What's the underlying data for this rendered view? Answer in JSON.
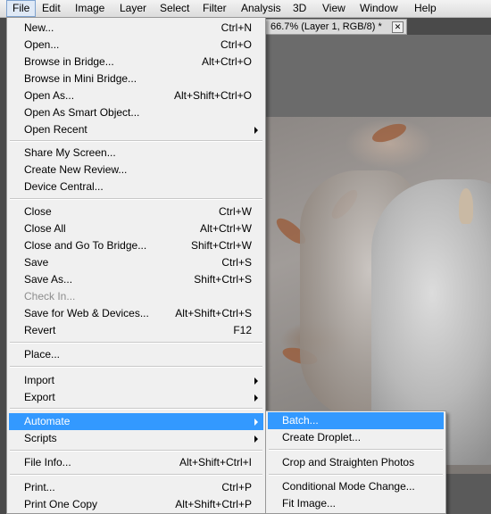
{
  "menubar": {
    "items": [
      {
        "label": "File",
        "active": true
      },
      {
        "label": "Edit"
      },
      {
        "label": "Image"
      },
      {
        "label": "Layer"
      },
      {
        "label": "Select"
      },
      {
        "label": "Filter"
      },
      {
        "label": "Analysis"
      },
      {
        "label": "3D"
      },
      {
        "label": "View"
      },
      {
        "label": "Window"
      },
      {
        "label": "Help"
      }
    ]
  },
  "document": {
    "tab_title": "66.7% (Layer 1, RGB/8) *",
    "close_glyph": "✕"
  },
  "file_menu": {
    "items": [
      {
        "label": "New...",
        "shortcut": "Ctrl+N"
      },
      {
        "label": "Open...",
        "shortcut": "Ctrl+O"
      },
      {
        "label": "Browse in Bridge...",
        "shortcut": "Alt+Ctrl+O"
      },
      {
        "label": "Browse in Mini Bridge...",
        "shortcut": ""
      },
      {
        "label": "Open As...",
        "shortcut": "Alt+Shift+Ctrl+O"
      },
      {
        "label": "Open As Smart Object...",
        "shortcut": ""
      },
      {
        "label": "Open Recent",
        "shortcut": "",
        "submenu": true
      },
      {
        "label": "Share My Screen...",
        "shortcut": ""
      },
      {
        "label": "Create New Review...",
        "shortcut": ""
      },
      {
        "label": "Device Central...",
        "shortcut": ""
      },
      {
        "label": "Close",
        "shortcut": "Ctrl+W"
      },
      {
        "label": "Close All",
        "shortcut": "Alt+Ctrl+W"
      },
      {
        "label": "Close and Go To Bridge...",
        "shortcut": "Shift+Ctrl+W"
      },
      {
        "label": "Save",
        "shortcut": "Ctrl+S"
      },
      {
        "label": "Save As...",
        "shortcut": "Shift+Ctrl+S"
      },
      {
        "label": "Check In...",
        "shortcut": "",
        "disabled": true
      },
      {
        "label": "Save for Web & Devices...",
        "shortcut": "Alt+Shift+Ctrl+S"
      },
      {
        "label": "Revert",
        "shortcut": "F12"
      },
      {
        "label": "Place...",
        "shortcut": ""
      },
      {
        "label": "Import",
        "shortcut": "",
        "submenu": true
      },
      {
        "label": "Export",
        "shortcut": "",
        "submenu": true
      },
      {
        "label": "Automate",
        "shortcut": "",
        "submenu": true,
        "highlighted": true
      },
      {
        "label": "Scripts",
        "shortcut": "",
        "submenu": true
      },
      {
        "label": "File Info...",
        "shortcut": "Alt+Shift+Ctrl+I"
      },
      {
        "label": "Print...",
        "shortcut": "Ctrl+P"
      },
      {
        "label": "Print One Copy",
        "shortcut": "Alt+Shift+Ctrl+P"
      }
    ]
  },
  "automate_submenu": {
    "items": [
      {
        "label": "Batch...",
        "highlighted": true
      },
      {
        "label": "Create Droplet..."
      },
      {
        "label": "Crop and Straighten Photos"
      },
      {
        "label": "Conditional Mode Change..."
      },
      {
        "label": "Fit Image..."
      }
    ]
  },
  "colors": {
    "highlight": "#3399ff",
    "menu_bg": "#f0f0f0",
    "disabled_text": "#8d8d8d"
  }
}
